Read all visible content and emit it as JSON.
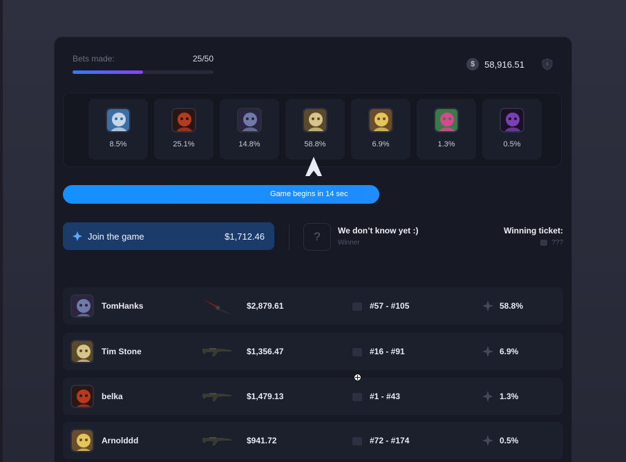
{
  "header": {
    "bets_label": "Bets made:",
    "bets_count": "25/50",
    "bets_progress": 0.5,
    "balance": "58,916.51",
    "coin_symbol": "$"
  },
  "carousel": {
    "players": [
      {
        "chance": "8.5%",
        "avatar_icon": "white-cat-avatar-icon",
        "colors": [
          "#c7d6e6",
          "#3c6ea8"
        ]
      },
      {
        "chance": "25.1%",
        "avatar_icon": "fire-demon-avatar-icon",
        "colors": [
          "#b53a1f",
          "#2a1714"
        ]
      },
      {
        "chance": "14.8%",
        "avatar_icon": "purple-elf-avatar-icon",
        "colors": [
          "#6f7aa8",
          "#2c2540"
        ]
      },
      {
        "chance": "58.8%",
        "avatar_icon": "golden-knight-avatar-icon",
        "colors": [
          "#d7c48a",
          "#5a4a2a"
        ]
      },
      {
        "chance": "6.9%",
        "avatar_icon": "blonde-hero-avatar-icon",
        "colors": [
          "#e3c55c",
          "#6a4d2a"
        ]
      },
      {
        "chance": "1.3%",
        "avatar_icon": "pink-creature-avatar-icon",
        "colors": [
          "#d9478e",
          "#3a7a4a"
        ]
      },
      {
        "chance": "0.5%",
        "avatar_icon": "shadow-beast-avatar-icon",
        "colors": [
          "#7a3fb0",
          "#1a1028"
        ]
      }
    ]
  },
  "timer": {
    "text": "Game begins in 14 sec",
    "progress": 0.53,
    "color": "#1590ff"
  },
  "join": {
    "label": "Join the game",
    "amount": "$1,712.46",
    "accent": "#5aa8ff"
  },
  "winner": {
    "placeholder": "?",
    "title": "We don’t know yet :)",
    "subtitle": "Winner"
  },
  "ticket": {
    "title": "Winning ticket:",
    "value": "???"
  },
  "bets": [
    {
      "name": "TomHanks",
      "weapon_icon": "knife-icon",
      "amount": "$2,879.61",
      "tickets": "#57 - #105",
      "chance": "58.8%",
      "avatar_colors": [
        "#6f7aa8",
        "#2c2540"
      ]
    },
    {
      "name": "Tim Stone",
      "weapon_icon": "rifle-icon",
      "amount": "$1,356.47",
      "tickets": "#16 - #91",
      "chance": "6.9%",
      "avatar_colors": [
        "#d7c48a",
        "#5a4a2a"
      ]
    },
    {
      "name": "belka",
      "weapon_icon": "rifle-icon",
      "amount": "$1,479.13",
      "tickets": "#1 - #43",
      "chance": "1.3%",
      "avatar_colors": [
        "#b53a1f",
        "#2a1714"
      ]
    },
    {
      "name": "Arnolddd",
      "weapon_icon": "rifle-icon",
      "amount": "$941.72",
      "tickets": "#72 - #174",
      "chance": "0.5%",
      "avatar_colors": [
        "#e3c55c",
        "#6a4d2a"
      ]
    }
  ]
}
